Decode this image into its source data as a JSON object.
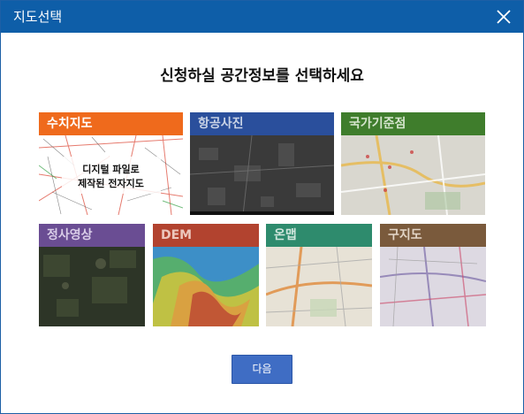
{
  "window": {
    "title": "지도선택"
  },
  "heading": "신청하실 공간정보를 선택하세요",
  "cards": [
    {
      "label": "수치지도",
      "overlay_line1": "디지털 파일로",
      "overlay_line2": "제작된 전자지도",
      "label_color": "#ef6a1c"
    },
    {
      "label": "항공사진",
      "label_color": "#2a4f9c"
    },
    {
      "label": "국가기준점",
      "label_color": "#3f7d2c"
    },
    {
      "label": "정사영상",
      "label_color": "#6a4d93"
    },
    {
      "label": "DEM",
      "label_color": "#b2432f"
    },
    {
      "label": "온맵",
      "label_color": "#2e8b6d"
    },
    {
      "label": "구지도",
      "label_color": "#7a5a3c"
    }
  ],
  "actions": {
    "next_label": "다음"
  },
  "icons": {
    "close": "close-icon"
  }
}
